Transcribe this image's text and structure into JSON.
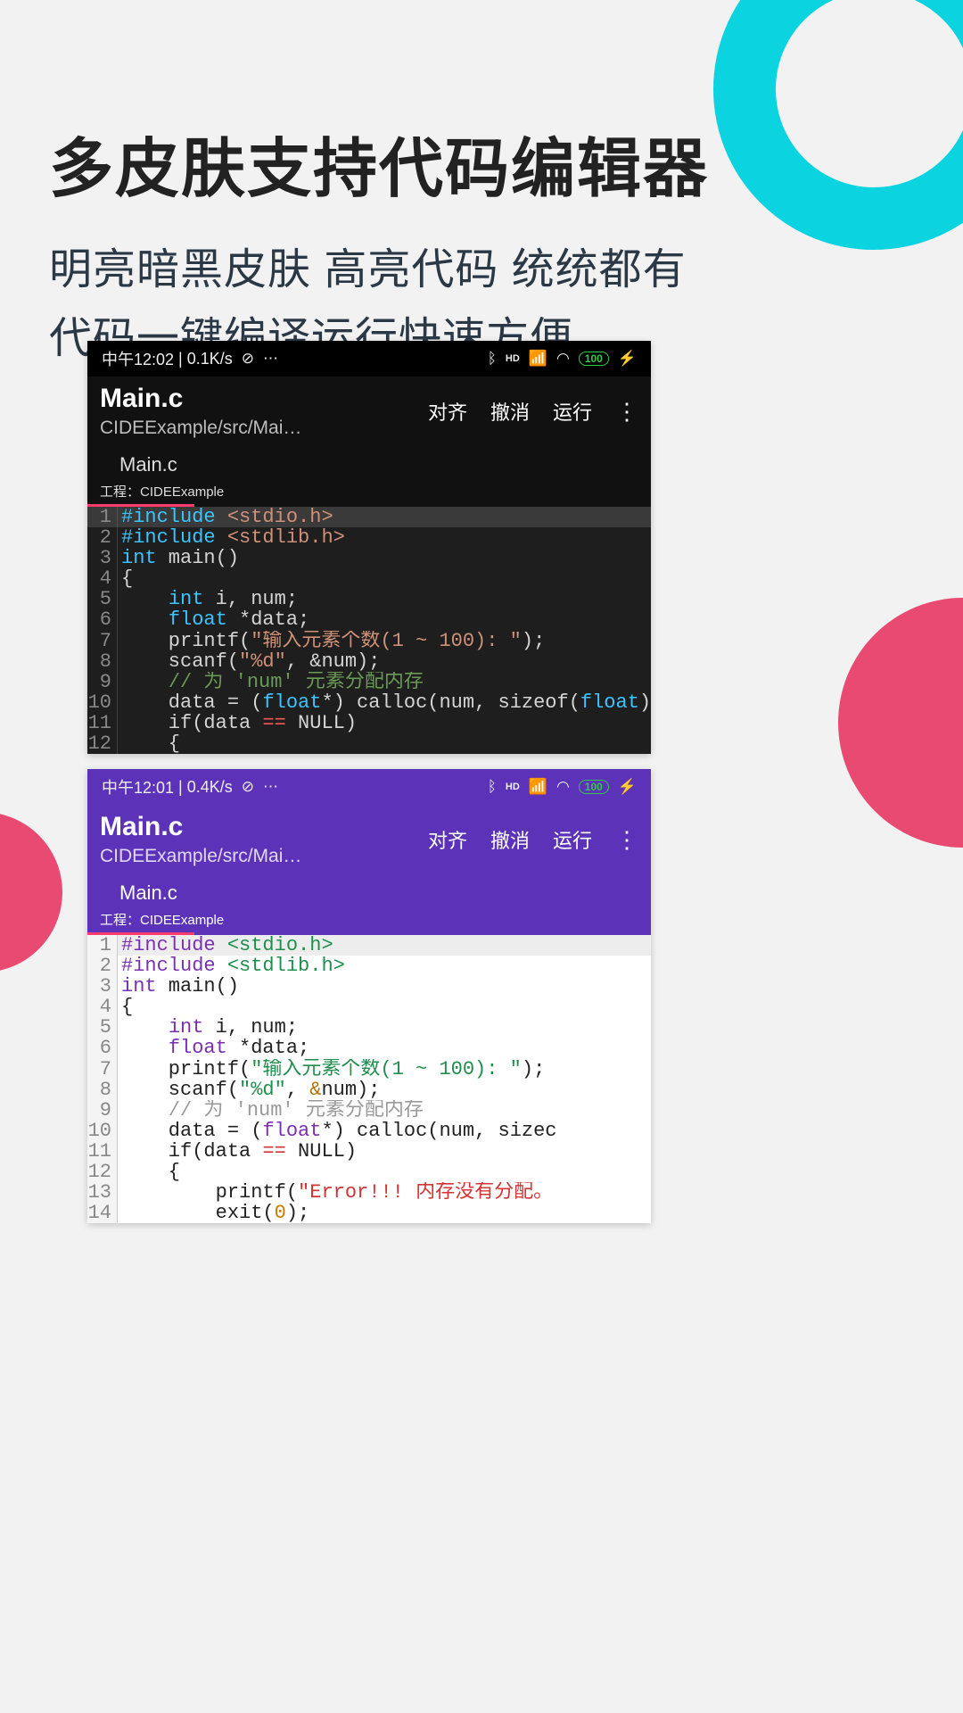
{
  "headline": {
    "title": "多皮肤支持代码编辑器",
    "line1": "明亮暗黑皮肤 高亮代码 统统都有",
    "line2": "代码一键编译运行快速方便"
  },
  "shared": {
    "toolbar_title": "Main.c",
    "toolbar_path": "CIDEExample/src/Mai…",
    "action_align": "对齐",
    "action_undo": "撤消",
    "action_run": "运行",
    "tab_name": "Main.c",
    "project_prefix": "工程：",
    "project_name": "CIDEExample",
    "battery": "100"
  },
  "dark": {
    "status_time": "中午12:02",
    "status_speed": "0.1K/s"
  },
  "light": {
    "status_time": "中午12:01",
    "status_speed": "0.4K/s"
  },
  "code": {
    "l1a": "#include ",
    "l1b": "<stdio.h>",
    "l2a": "#include ",
    "l2b": "<stdlib.h>",
    "l3a": "int",
    "l3b": " main()",
    "l4": "{",
    "l5a": "    ",
    "l5b": "int",
    "l5c": " i, num;",
    "l6a": "    ",
    "l6b": "float",
    "l6c": " *data;",
    "l7a": "    printf(",
    "l7b": "\"输入元素个数(1 ~ 100): \"",
    "l7c": ");",
    "l8a": "    scanf(",
    "l8b": "\"%d\"",
    "l8c": ", ",
    "l8amp": "&",
    "l8d": "num);",
    "l9a": "    ",
    "l9b": "// 为 'num' 元素分配内存",
    "l10a": "    data = (",
    "l10b": "float",
    "l10c": "*) calloc(num, sizeof(",
    "l10d": "float",
    "l10e": "));",
    "l10c_light": "*) calloc(num, sizec",
    "l11a": "    if(data ",
    "l11b": "==",
    "l11c": " NULL)",
    "l12": "    {",
    "l13a": "        printf(",
    "l13b": "\"Error!!! 内存没有分配。",
    "l14a": "        exit(",
    "l14b": "0",
    "l14c": ");"
  }
}
